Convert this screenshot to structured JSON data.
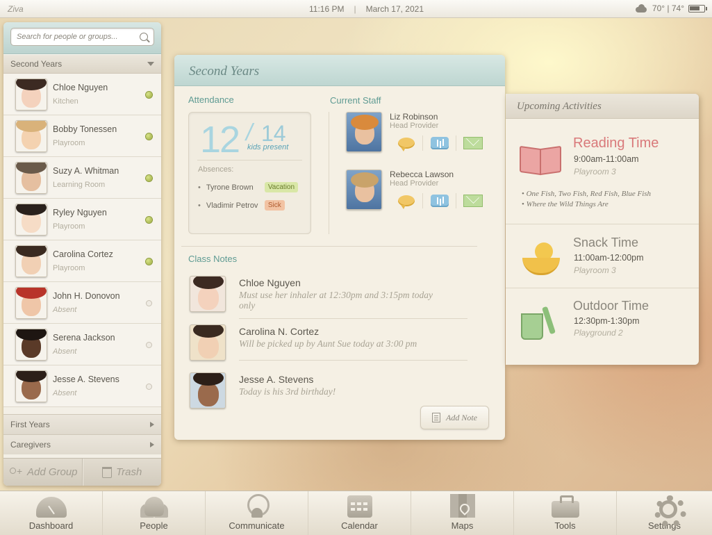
{
  "status_bar": {
    "app_name": "Ziva",
    "time": "11:16 PM",
    "separator": "|",
    "date": "March 17, 2021",
    "weather_icon": "cloud-icon",
    "temperature": "70° | 74°",
    "battery_icon": "battery-icon"
  },
  "sidebar": {
    "search_placeholder": "Search for people or groups...",
    "active_group": "Second Years",
    "people": [
      {
        "name": "Chloe Nguyen",
        "room": "Kitchen",
        "status": "present"
      },
      {
        "name": "Bobby Tonessen",
        "room": "Playroom",
        "status": "present"
      },
      {
        "name": "Suzy A. Whitman",
        "room": "Learning Room",
        "status": "present"
      },
      {
        "name": "Ryley Nguyen",
        "room": "Playroom",
        "status": "present"
      },
      {
        "name": "Carolina Cortez",
        "room": "Playroom",
        "status": "present"
      },
      {
        "name": "John H. Donovon",
        "room": "Absent",
        "status": "absent"
      },
      {
        "name": "Serena Jackson",
        "room": "Absent",
        "status": "absent"
      },
      {
        "name": "Jesse A. Stevens",
        "room": "Absent",
        "status": "absent"
      }
    ],
    "other_groups": [
      "First Years",
      "Caregivers"
    ],
    "footer": {
      "add_group": "Add Group",
      "trash": "Trash"
    }
  },
  "class_panel": {
    "title": "Second Years",
    "attendance": {
      "label": "Attendance",
      "present": "12",
      "slash": "/",
      "total": "14",
      "caption": "kids present",
      "absences_label": "Absences:",
      "absences": [
        {
          "name": "Tyrone Brown",
          "reason": "Vacation"
        },
        {
          "name": "Vladimir Petrov",
          "reason": "Sick"
        }
      ]
    },
    "staff": {
      "label": "Current Staff",
      "members": [
        {
          "name": "Liz Robinson",
          "role": "Head Provider"
        },
        {
          "name": "Rebecca Lawson",
          "role": "Head Provider"
        }
      ]
    },
    "notes": {
      "label": "Class Notes",
      "items": [
        {
          "name": "Chloe Nguyen",
          "text": "Must use her inhaler at 12:30pm and 3:15pm today only"
        },
        {
          "name": "Carolina N. Cortez",
          "text": "Will be picked up by Aunt Sue today at 3:00 pm"
        },
        {
          "name": "Jesse A. Stevens",
          "text": "Today is his 3rd birthday!"
        }
      ],
      "add_note": "Add Note"
    }
  },
  "activities": {
    "title": "Upcoming Activities",
    "items": [
      {
        "name": "Reading Time",
        "time": "9:00am-11:00am",
        "place": "Playroom 3",
        "icon": "book-icon",
        "color": "#d9797a",
        "books": [
          "One Fish, Two Fish, Red Fish, Blue Fish",
          "Where the Wild Things Are"
        ]
      },
      {
        "name": "Snack Time",
        "time": "11:00am-12:00pm",
        "place": "Playroom 3",
        "icon": "fruit-icon",
        "color": "#8a867c"
      },
      {
        "name": "Outdoor Time",
        "time": "12:30pm-1:30pm",
        "place": "Playground 2",
        "icon": "bucket-icon",
        "color": "#8a867c"
      }
    ]
  },
  "dock": [
    {
      "label": "Dashboard",
      "icon": "dashboard-icon"
    },
    {
      "label": "People",
      "icon": "people-icon"
    },
    {
      "label": "Communicate",
      "icon": "communicate-icon"
    },
    {
      "label": "Calendar",
      "icon": "calendar-icon"
    },
    {
      "label": "Maps",
      "icon": "maps-icon"
    },
    {
      "label": "Tools",
      "icon": "tools-icon"
    },
    {
      "label": "Settings",
      "icon": "settings-icon"
    }
  ]
}
